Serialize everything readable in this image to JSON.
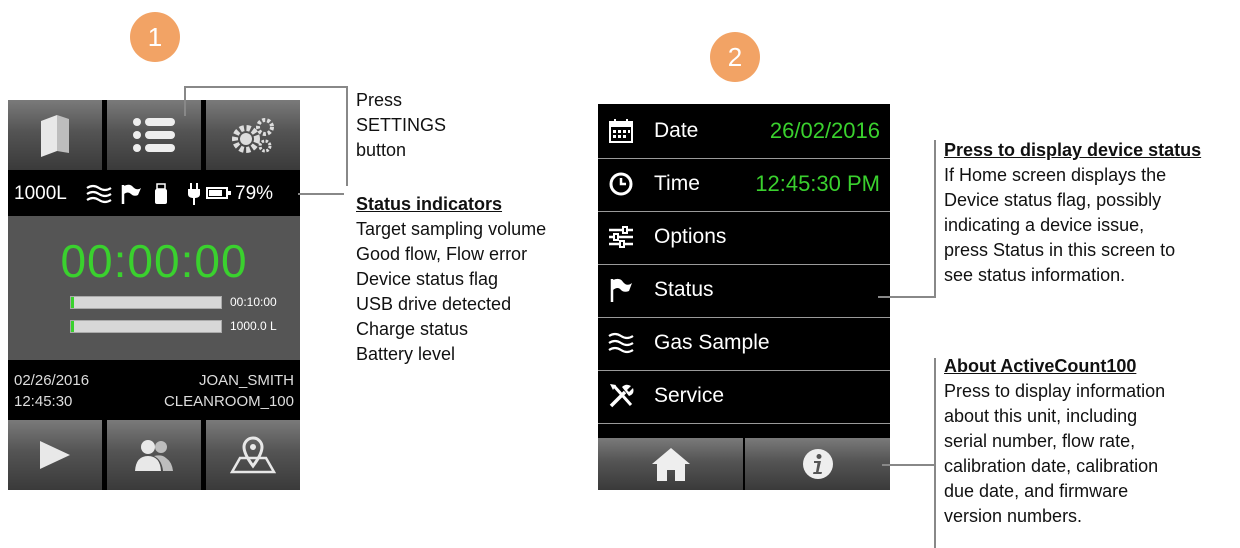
{
  "badges": [
    "1",
    "2"
  ],
  "screen1": {
    "top_buttons": [
      {
        "icon": "book-icon"
      },
      {
        "icon": "list-icon"
      },
      {
        "icon": "gears-icon"
      }
    ],
    "status_bar": {
      "volume": "1000L",
      "battery_percent": "79%",
      "battery_level": 79,
      "icons": [
        "flow-icon",
        "flag-icon",
        "usb-drive-icon",
        "plug-icon",
        "battery-icon"
      ]
    },
    "timer": "00:00:00",
    "progress": [
      {
        "label": "00:10:00",
        "fraction": 0.02
      },
      {
        "label": "1000.0 L",
        "fraction": 0.02
      }
    ],
    "info": {
      "date": "02/26/2016",
      "time": "12:45:30",
      "user": "JOAN_SMITH",
      "location": "CLEANROOM_100"
    },
    "bottom_buttons": [
      {
        "icon": "play-icon"
      },
      {
        "icon": "users-icon"
      },
      {
        "icon": "map-pin-icon"
      }
    ]
  },
  "callouts": {
    "settings": [
      "Press",
      "SETTINGS",
      "button"
    ],
    "status_indicators": {
      "heading": "Status indicators",
      "lines": [
        "Target sampling volume",
        "Good flow, Flow error",
        "Device status flag",
        "USB drive detected",
        "Charge status",
        "Battery level"
      ]
    },
    "device_status": {
      "heading": "Press to display device status",
      "lines": [
        "If Home screen displays the",
        "Device status flag, possibly",
        "indicating a device issue,",
        "press Status in this screen to",
        "see status information."
      ]
    },
    "about": {
      "heading": "About ActiveCount100",
      "lines": [
        "Press to display information",
        "about this unit, including",
        "serial number, flow rate,",
        "calibration date, calibration",
        "due date, and firmware",
        "version numbers."
      ]
    }
  },
  "screen2": {
    "rows": [
      {
        "label": "Date",
        "value": "26/02/2016",
        "icon": "calendar-icon"
      },
      {
        "label": "Time",
        "value": "12:45:30 PM",
        "icon": "clock-icon"
      },
      {
        "label": "Options",
        "value": "",
        "icon": "sliders-icon"
      },
      {
        "label": "Status",
        "value": "",
        "icon": "flag-icon"
      },
      {
        "label": "Gas Sample",
        "value": "",
        "icon": "wave-icon"
      },
      {
        "label": "Service",
        "value": "",
        "icon": "tools-icon"
      }
    ],
    "bottom_buttons": [
      {
        "icon": "home-icon"
      },
      {
        "icon": "info-icon"
      }
    ]
  }
}
